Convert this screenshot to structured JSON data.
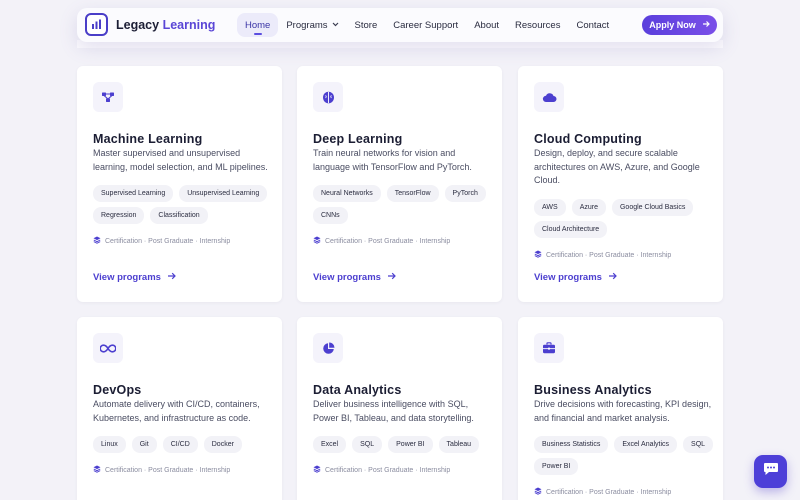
{
  "header": {
    "logo_primary": "Legacy",
    "logo_accent": "Learning",
    "nav": [
      {
        "label": "Home",
        "active": true
      },
      {
        "label": "Programs",
        "dropdown": true
      },
      {
        "label": "Store"
      },
      {
        "label": "Career Support"
      },
      {
        "label": "About"
      },
      {
        "label": "Resources"
      },
      {
        "label": "Contact"
      }
    ],
    "cta_label": "Apply Now"
  },
  "cards": [
    {
      "icon": "network-nodes-icon",
      "title": "Machine Learning",
      "description": "Master supervised and unsupervised learning, model selection, and ML pipelines.",
      "tags": [
        "Supervised Learning",
        "Unsupervised Learning",
        "Regression",
        "Classification"
      ],
      "meta": "Certification · Post Graduate · Internship",
      "link": "View programs"
    },
    {
      "icon": "brain-icon",
      "title": "Deep Learning",
      "description": "Train neural networks for vision and language with TensorFlow and PyTorch.",
      "tags": [
        "Neural Networks",
        "TensorFlow",
        "PyTorch",
        "CNNs"
      ],
      "meta": "Certification · Post Graduate · Internship",
      "link": "View programs"
    },
    {
      "icon": "cloud-icon",
      "title": "Cloud Computing",
      "description": "Design, deploy, and secure scalable architectures on AWS, Azure, and Google Cloud.",
      "tags": [
        "AWS",
        "Azure",
        "Google Cloud Basics",
        "Cloud Architecture"
      ],
      "meta": "Certification · Post Graduate · Internship",
      "link": "View programs"
    },
    {
      "icon": "infinity-icon",
      "title": "DevOps",
      "description": "Automate delivery with CI/CD, containers, Kubernetes, and infrastructure as code.",
      "tags": [
        "Linux",
        "Git",
        "CI/CD",
        "Docker"
      ],
      "meta": "Certification · Post Graduate · Internship",
      "link": ""
    },
    {
      "icon": "pie-chart-icon",
      "title": "Data Analytics",
      "description": "Deliver business intelligence with SQL, Power BI, Tableau, and data storytelling.",
      "tags": [
        "Excel",
        "SQL",
        "Power BI",
        "Tableau"
      ],
      "meta": "Certification · Post Graduate · Internship",
      "link": ""
    },
    {
      "icon": "briefcase-icon",
      "title": "Business Analytics",
      "description": "Drive decisions with forecasting, KPI design, and financial and market analysis.",
      "tags": [
        "Business Statistics",
        "Excel Analytics",
        "SQL",
        "Power BI"
      ],
      "meta": "Certification · Post Graduate · Internship",
      "link": ""
    }
  ],
  "chat_widget": {
    "icon": "chat-bubble-icon"
  },
  "colors": {
    "accent": "#4c3fcf",
    "background": "#f3f2f8"
  }
}
